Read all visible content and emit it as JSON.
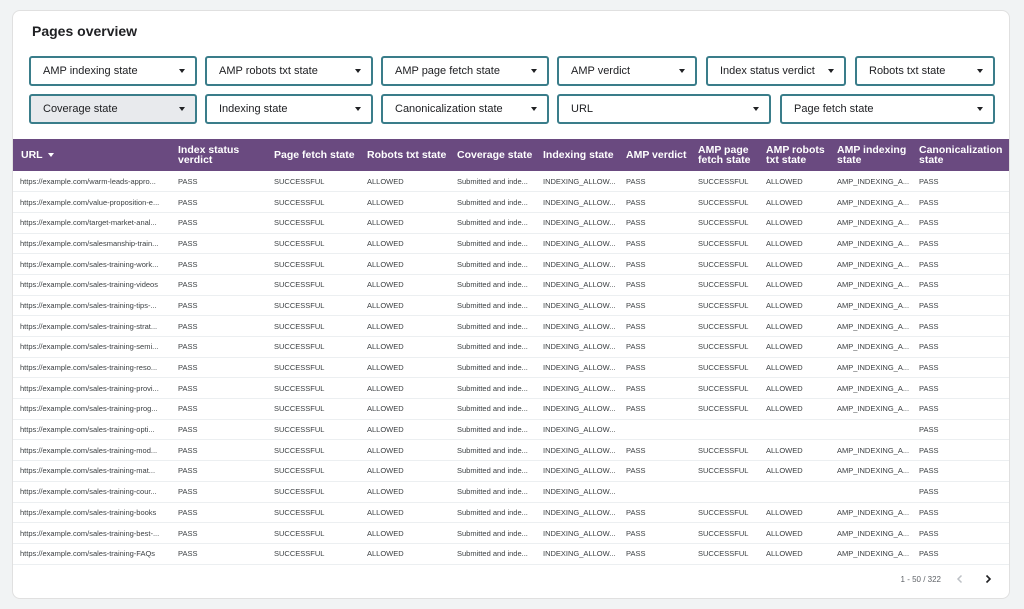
{
  "panel": {
    "title": "Pages overview"
  },
  "filters": {
    "row1": [
      "AMP indexing state",
      "AMP robots txt state",
      "AMP page fetch state",
      "AMP verdict",
      "Index status verdict",
      "Robots txt state"
    ],
    "row2": [
      "Coverage state",
      "Indexing state",
      "Canonicalization state",
      "URL",
      "Page fetch state"
    ]
  },
  "table": {
    "columns": [
      "URL",
      "Index status verdict",
      "Page fetch state",
      "Robots txt state",
      "Coverage state",
      "Indexing state",
      "AMP verdict",
      "AMP page fetch state",
      "AMP robots txt state",
      "AMP indexing state",
      "Canonicalization state"
    ],
    "rows": [
      [
        "https://example.com/warm-leads-appro...",
        "PASS",
        "SUCCESSFUL",
        "ALLOWED",
        "Submitted and inde...",
        "INDEXING_ALLOW...",
        "PASS",
        "SUCCESSFUL",
        "ALLOWED",
        "AMP_INDEXING_A...",
        "PASS"
      ],
      [
        "https://example.com/value-proposition-e...",
        "PASS",
        "SUCCESSFUL",
        "ALLOWED",
        "Submitted and inde...",
        "INDEXING_ALLOW...",
        "PASS",
        "SUCCESSFUL",
        "ALLOWED",
        "AMP_INDEXING_A...",
        "PASS"
      ],
      [
        "https://example.com/target-market-anal...",
        "PASS",
        "SUCCESSFUL",
        "ALLOWED",
        "Submitted and inde...",
        "INDEXING_ALLOW...",
        "PASS",
        "SUCCESSFUL",
        "ALLOWED",
        "AMP_INDEXING_A...",
        "PASS"
      ],
      [
        "https://example.com/salesmanship-train...",
        "PASS",
        "SUCCESSFUL",
        "ALLOWED",
        "Submitted and inde...",
        "INDEXING_ALLOW...",
        "PASS",
        "SUCCESSFUL",
        "ALLOWED",
        "AMP_INDEXING_A...",
        "PASS"
      ],
      [
        "https://example.com/sales-training-work...",
        "PASS",
        "SUCCESSFUL",
        "ALLOWED",
        "Submitted and inde...",
        "INDEXING_ALLOW...",
        "PASS",
        "SUCCESSFUL",
        "ALLOWED",
        "AMP_INDEXING_A...",
        "PASS"
      ],
      [
        "https://example.com/sales-training-videos",
        "PASS",
        "SUCCESSFUL",
        "ALLOWED",
        "Submitted and inde...",
        "INDEXING_ALLOW...",
        "PASS",
        "SUCCESSFUL",
        "ALLOWED",
        "AMP_INDEXING_A...",
        "PASS"
      ],
      [
        "https://example.com/sales-training-tips-...",
        "PASS",
        "SUCCESSFUL",
        "ALLOWED",
        "Submitted and inde...",
        "INDEXING_ALLOW...",
        "PASS",
        "SUCCESSFUL",
        "ALLOWED",
        "AMP_INDEXING_A...",
        "PASS"
      ],
      [
        "https://example.com/sales-training-strat...",
        "PASS",
        "SUCCESSFUL",
        "ALLOWED",
        "Submitted and inde...",
        "INDEXING_ALLOW...",
        "PASS",
        "SUCCESSFUL",
        "ALLOWED",
        "AMP_INDEXING_A...",
        "PASS"
      ],
      [
        "https://example.com/sales-training-semi...",
        "PASS",
        "SUCCESSFUL",
        "ALLOWED",
        "Submitted and inde...",
        "INDEXING_ALLOW...",
        "PASS",
        "SUCCESSFUL",
        "ALLOWED",
        "AMP_INDEXING_A...",
        "PASS"
      ],
      [
        "https://example.com/sales-training-reso...",
        "PASS",
        "SUCCESSFUL",
        "ALLOWED",
        "Submitted and inde...",
        "INDEXING_ALLOW...",
        "PASS",
        "SUCCESSFUL",
        "ALLOWED",
        "AMP_INDEXING_A...",
        "PASS"
      ],
      [
        "https://example.com/sales-training-provi...",
        "PASS",
        "SUCCESSFUL",
        "ALLOWED",
        "Submitted and inde...",
        "INDEXING_ALLOW...",
        "PASS",
        "SUCCESSFUL",
        "ALLOWED",
        "AMP_INDEXING_A...",
        "PASS"
      ],
      [
        "https://example.com/sales-training-prog...",
        "PASS",
        "SUCCESSFUL",
        "ALLOWED",
        "Submitted and inde...",
        "INDEXING_ALLOW...",
        "PASS",
        "SUCCESSFUL",
        "ALLOWED",
        "AMP_INDEXING_A...",
        "PASS"
      ],
      [
        "https://example.com/sales-training-opti...",
        "PASS",
        "SUCCESSFUL",
        "ALLOWED",
        "Submitted and inde...",
        "INDEXING_ALLOW...",
        "",
        "",
        "",
        "",
        "PASS"
      ],
      [
        "https://example.com/sales-training-mod...",
        "PASS",
        "SUCCESSFUL",
        "ALLOWED",
        "Submitted and inde...",
        "INDEXING_ALLOW...",
        "PASS",
        "SUCCESSFUL",
        "ALLOWED",
        "AMP_INDEXING_A...",
        "PASS"
      ],
      [
        "https://example.com/sales-training-mat...",
        "PASS",
        "SUCCESSFUL",
        "ALLOWED",
        "Submitted and inde...",
        "INDEXING_ALLOW...",
        "PASS",
        "SUCCESSFUL",
        "ALLOWED",
        "AMP_INDEXING_A...",
        "PASS"
      ],
      [
        "https://example.com/sales-training-cour...",
        "PASS",
        "SUCCESSFUL",
        "ALLOWED",
        "Submitted and inde...",
        "INDEXING_ALLOW...",
        "",
        "",
        "",
        "",
        "PASS"
      ],
      [
        "https://example.com/sales-training-books",
        "PASS",
        "SUCCESSFUL",
        "ALLOWED",
        "Submitted and inde...",
        "INDEXING_ALLOW...",
        "PASS",
        "SUCCESSFUL",
        "ALLOWED",
        "AMP_INDEXING_A...",
        "PASS"
      ],
      [
        "https://example.com/sales-training-best-...",
        "PASS",
        "SUCCESSFUL",
        "ALLOWED",
        "Submitted and inde...",
        "INDEXING_ALLOW...",
        "PASS",
        "SUCCESSFUL",
        "ALLOWED",
        "AMP_INDEXING_A...",
        "PASS"
      ],
      [
        "https://example.com/sales-training-FAQs",
        "PASS",
        "SUCCESSFUL",
        "ALLOWED",
        "Submitted and inde...",
        "INDEXING_ALLOW...",
        "PASS",
        "SUCCESSFUL",
        "ALLOWED",
        "AMP_INDEXING_A...",
        "PASS"
      ]
    ]
  },
  "pagination": {
    "range": "1 - 50 / 322"
  },
  "icons": {
    "sort": "sort-desc-icon",
    "dropdown": "chevron-down-icon",
    "prev": "chevron-left-icon",
    "next": "chevron-right-icon"
  },
  "colors": {
    "header_bg": "#6a4a80",
    "filter_border": "#3a7d8a",
    "active_filter_bg": "#e8eaed"
  }
}
